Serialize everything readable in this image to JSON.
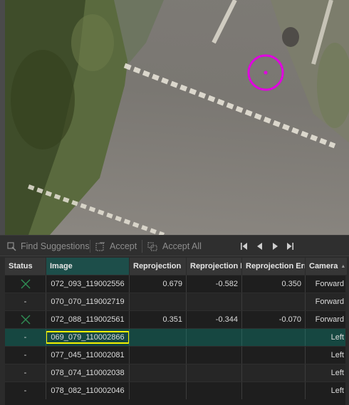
{
  "toolbar": {
    "find_suggestions": "Find Suggestions",
    "accept": "Accept",
    "accept_all": "Accept All",
    "icons": [
      "find-suggestions-icon",
      "accept-icon",
      "accept-all-icon",
      "first-icon",
      "previous-icon",
      "next-icon",
      "last-icon"
    ]
  },
  "table": {
    "columns": [
      "Status",
      "Image",
      "Reprojection",
      "Reprojection E",
      "Reprojection Err",
      "Camera"
    ],
    "sorted_column": "Camera",
    "rows": [
      {
        "status": "x-icon",
        "image": "072_093_119002556",
        "r1": "0.679",
        "r2": "-0.582",
        "r3": "0.350",
        "camera": "Forward"
      },
      {
        "status": "-",
        "image": "070_070_119002719",
        "r1": "",
        "r2": "",
        "r3": "",
        "camera": "Forward"
      },
      {
        "status": "x-icon",
        "image": "072_088_119002561",
        "r1": "0.351",
        "r2": "-0.344",
        "r3": "-0.070",
        "camera": "Forward"
      },
      {
        "status": "-",
        "image": "069_079_110002866",
        "r1": "",
        "r2": "",
        "r3": "",
        "camera": "Left",
        "selected": true
      },
      {
        "status": "-",
        "image": "077_045_110002081",
        "r1": "",
        "r2": "",
        "r3": "",
        "camera": "Left"
      },
      {
        "status": "-",
        "image": "078_074_110002038",
        "r1": "",
        "r2": "",
        "r3": "",
        "camera": "Left"
      },
      {
        "status": "-",
        "image": "078_082_110002046",
        "r1": "",
        "r2": "",
        "r3": "",
        "camera": "Left"
      }
    ]
  },
  "colors": {
    "marker": "#e000e0",
    "highlight_box": "#f2f200",
    "selected_row": "#164741",
    "status_x": "#2f8f55"
  }
}
